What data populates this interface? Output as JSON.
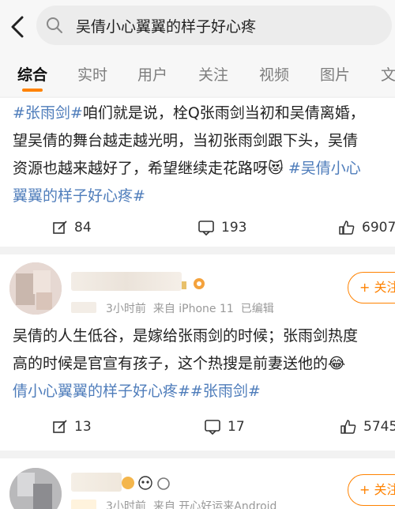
{
  "search": {
    "query": "吴倩小心翼翼的样子好心疼"
  },
  "tabs": [
    "综合",
    "实时",
    "用户",
    "关注",
    "视频",
    "图片",
    "文"
  ],
  "post1": {
    "lines": [
      [
        "#张雨剑#",
        "咱们就是说，栓Q张雨剑当初和吴倩离婚，"
      ],
      [
        "",
        "望吴倩的舞台越走越光明，当初张雨剑跟下头，吴倩"
      ],
      [
        "",
        "资源也越来越好了，希望继续走花路呀😻 ",
        "#吴倩小心"
      ],
      [
        "翼翼的样子好心疼#",
        ""
      ]
    ],
    "reposts": "84",
    "comments": "193",
    "likes": "6907"
  },
  "post2": {
    "time": "3小时前",
    "source": "来自 iPhone 11",
    "edited": "已编辑",
    "follow_label": "+ 关注",
    "lines": [
      [
        "",
        "吴倩的人生低谷，是嫁给张雨剑的时候；张雨剑热度"
      ],
      [
        "",
        "高的时候是官宣有孩子，这个热搜是前妻送他的😂"
      ],
      [
        "倩小心翼翼的样子好心疼##张雨剑#",
        ""
      ]
    ],
    "reposts": "13",
    "comments": "17",
    "likes": "5745"
  },
  "post3": {
    "time": "3小时前",
    "source": "来自 开心好运来Android",
    "follow_label": "+ 关注"
  },
  "colors": {
    "accent": "#ff8200",
    "link": "#4f7dbb"
  }
}
